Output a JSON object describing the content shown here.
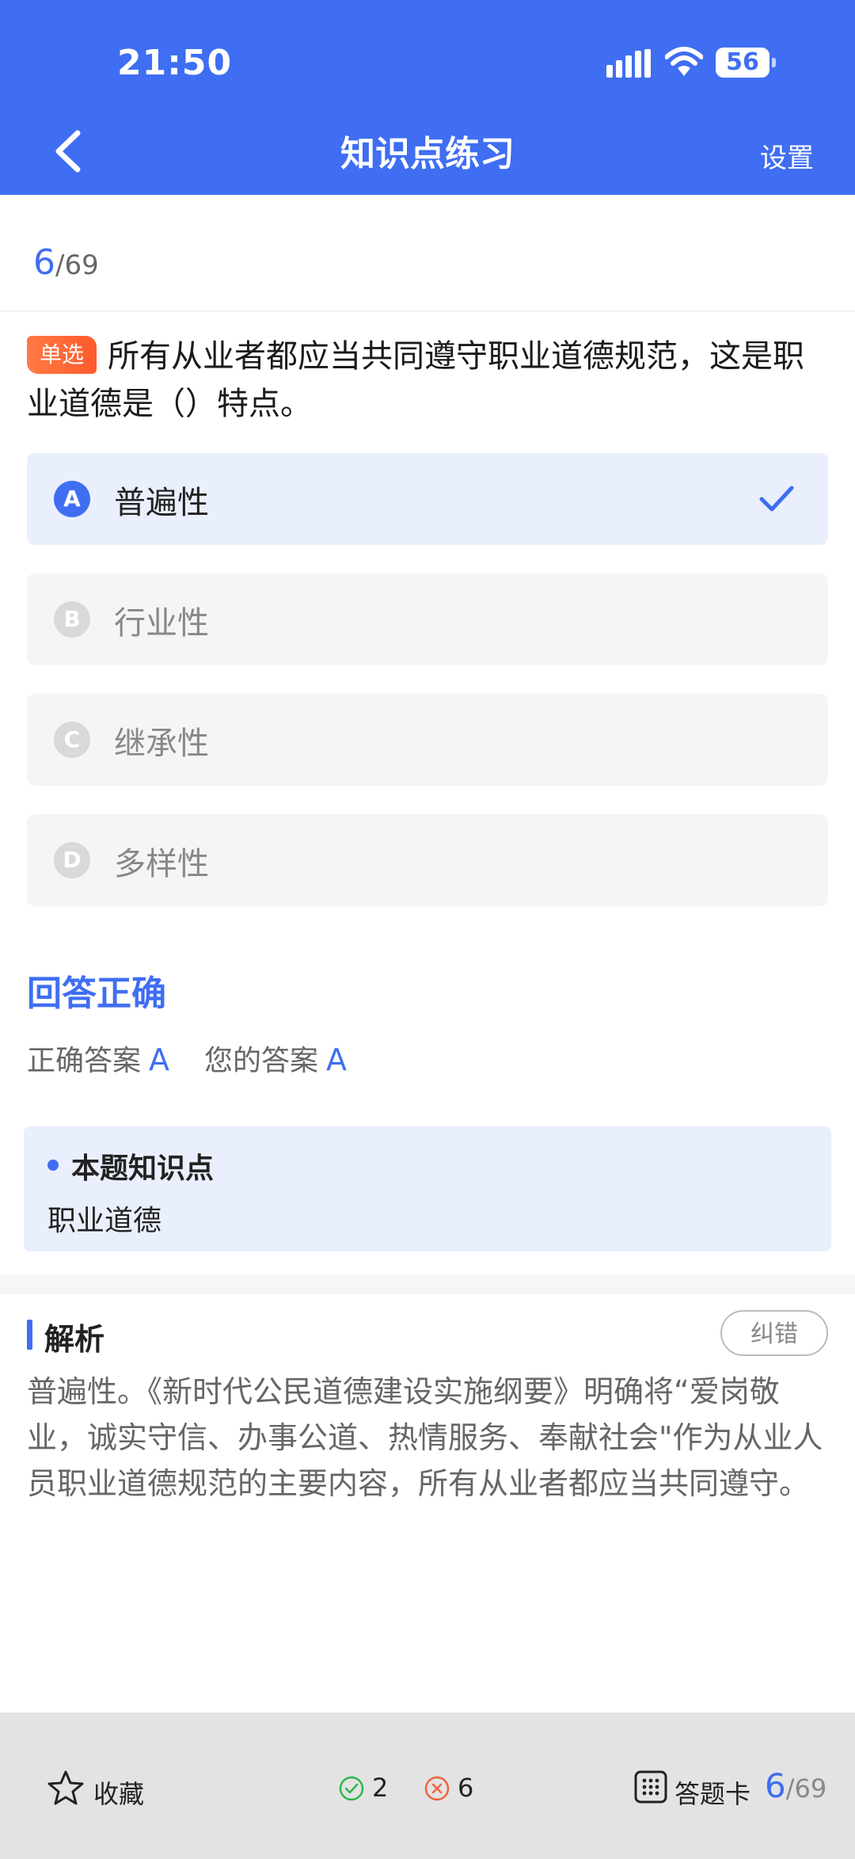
{
  "status": {
    "time": "21:50",
    "battery": "56"
  },
  "nav": {
    "title": "知识点练习",
    "settings": "设置"
  },
  "progress": {
    "current": "6",
    "total": "/69"
  },
  "question": {
    "type": "单选",
    "text": "所有从业者都应当共同遵守职业道德规范，这是职业道德是（）特点。"
  },
  "options": [
    {
      "letter": "A",
      "text": "普遍性",
      "selected": true
    },
    {
      "letter": "B",
      "text": "行业性",
      "selected": false
    },
    {
      "letter": "C",
      "text": "继承性",
      "selected": false
    },
    {
      "letter": "D",
      "text": "多样性",
      "selected": false
    }
  ],
  "result": {
    "title": "回答正确",
    "correct_label": "正确答案",
    "correct_value": "A",
    "yours_label": "您的答案",
    "yours_value": "A"
  },
  "knowledge": {
    "title": "本题知识点",
    "value": "职业道德"
  },
  "analysis": {
    "title": "解析",
    "report_label": "纠错",
    "text": "普遍性。《新时代公民道德建设实施纲要》明确将“爱岗敬业，诚实守信、办事公道、热情服务、奉献社会\"作为从业人员职业道德规范的主要内容，所有从业者都应当共同遵守。"
  },
  "bottom": {
    "favorite_label": "收藏",
    "correct_count": "2",
    "wrong_count": "6",
    "card_label": "答题卡",
    "current": "6",
    "total": "/69"
  },
  "colors": {
    "accent": "#3f6ef2",
    "badge": "#ff6a3d",
    "correct": "#2db84d",
    "wrong": "#f0643c"
  },
  "icons": [
    "back-icon",
    "check-icon",
    "star-icon",
    "check-circle-icon",
    "x-circle-icon",
    "grid-icon"
  ]
}
